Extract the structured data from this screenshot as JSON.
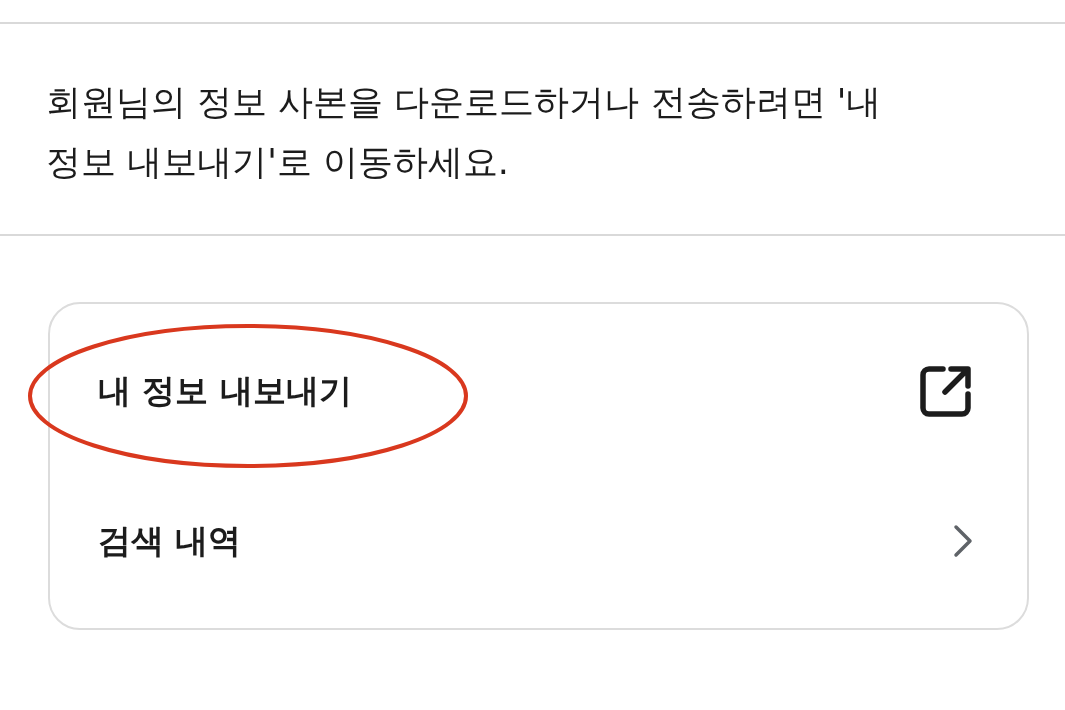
{
  "description": "회원님의 정보 사본을 다운로드하거나 전송하려면 '내 정보 내보내기'로 이동하세요.",
  "menu": [
    {
      "label": "내 정보 내보내기",
      "kind": "external",
      "highlighted": true
    },
    {
      "label": "검색 내역",
      "kind": "chevron",
      "highlighted": false
    }
  ]
}
